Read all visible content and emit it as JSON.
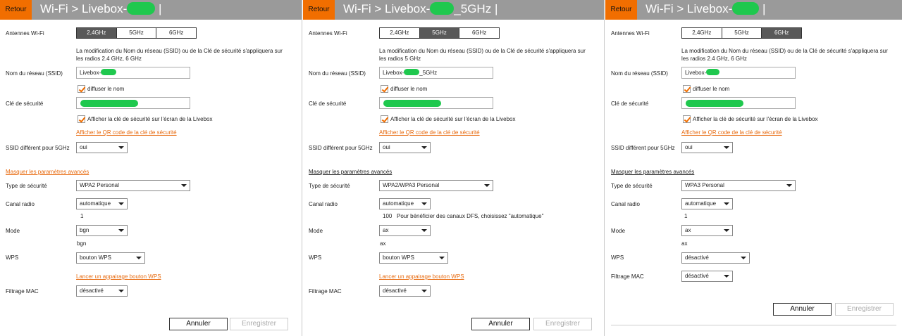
{
  "common": {
    "back_label": "Retour",
    "title_prefix": "Wi-Fi > Livebox-",
    "title_cursor": "|",
    "antennas_label": "Antennes Wi-Fi",
    "bands": [
      "2,4GHz",
      "5GHz",
      "6GHz"
    ],
    "ssid_label": "Nom du réseau (SSID)",
    "ssid_prefix": "Livebox-",
    "broadcast_label": "diffuser le nom",
    "key_label": "Clé de sécurité",
    "show_key_label": "Afficher la clé de sécurité sur l'écran de la Livebox",
    "qr_link": "Afficher le QR code de la clé de sécurité",
    "ssid5_label": "SSID différent pour 5GHz",
    "ssid5_value": "oui",
    "advanced_link": "Masquer les paramètres avancés",
    "security_type_label": "Type de sécurité",
    "channel_label": "Canal radio",
    "channel_value": "automatique",
    "mode_label": "Mode",
    "wps_label": "WPS",
    "mac_label": "Filtrage MAC",
    "mac_value": "désactivé",
    "cancel_label": "Annuler",
    "save_label": "Enregistrer"
  },
  "panels": [
    {
      "title_suffix": "",
      "active_band": 0,
      "note": "La modification du Nom du réseau (SSID) ou de la Clé de sécurité s'appliquera sur les radios 2.4 GHz, 6 GHz",
      "ssid_suffix": "",
      "security_type": "WPA2 Personal",
      "channel_current": "1",
      "channel_hint": "",
      "mode_value": "bgn",
      "mode_current": "bgn",
      "wps_value": "bouton WPS",
      "wps_link": "Lancer un appairage bouton WPS"
    },
    {
      "title_suffix": "_5GHz",
      "active_band": 1,
      "note": "La modification du Nom du réseau (SSID) ou de la Clé de sécurité s'appliquera sur les radios 5 GHz",
      "ssid_suffix": "_5GHz",
      "security_type": "WPA2/WPA3 Personal",
      "channel_current": "100",
      "channel_hint": "Pour bénéficier des canaux DFS, choisissez \"automatique\"",
      "mode_value": "ax",
      "mode_current": "ax",
      "wps_value": "bouton WPS",
      "wps_link": "Lancer un appairage bouton WPS"
    },
    {
      "title_suffix": "",
      "active_band": 2,
      "note": "La modification du Nom du réseau (SSID) ou de la Clé de sécurité s'appliquera sur les radios 2.4 GHz, 6 GHz",
      "ssid_suffix": "",
      "security_type": "WPA3 Personal",
      "channel_current": "1",
      "channel_hint": "",
      "mode_value": "ax",
      "mode_current": "ax",
      "wps_value": "désactivé",
      "wps_link": ""
    }
  ]
}
